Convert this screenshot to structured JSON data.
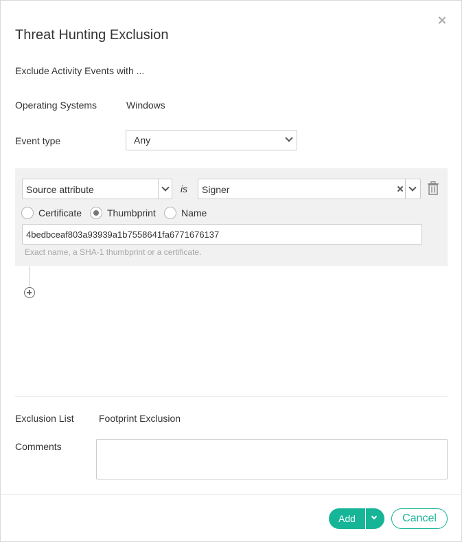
{
  "dialog": {
    "title": "Threat Hunting Exclusion",
    "close_icon": "close-icon"
  },
  "subtitle": "Exclude Activity Events with ...",
  "os": {
    "label": "Operating Systems",
    "value": "Windows"
  },
  "event_type": {
    "label": "Event type",
    "selected": "Any"
  },
  "condition": {
    "attribute_selected": "Source attribute",
    "operator": "is",
    "value_selected": "Signer",
    "radio_options": [
      {
        "label": "Certificate",
        "checked": false
      },
      {
        "label": "Thumbprint",
        "checked": true
      },
      {
        "label": "Name",
        "checked": false
      }
    ],
    "input_value": "4bedbceaf803a93939a1b7558641fa6771676137",
    "hint": "Exact name, a SHA-1 thumbprint or a certificate."
  },
  "exclusion_list": {
    "label": "Exclusion List",
    "value": "Footprint Exclusion"
  },
  "comments": {
    "label": "Comments",
    "value": ""
  },
  "buttons": {
    "add": "Add",
    "cancel": "Cancel"
  },
  "colors": {
    "accent": "#16b597",
    "panel_bg": "#f1f1f1",
    "hint": "#a6a6a6"
  }
}
